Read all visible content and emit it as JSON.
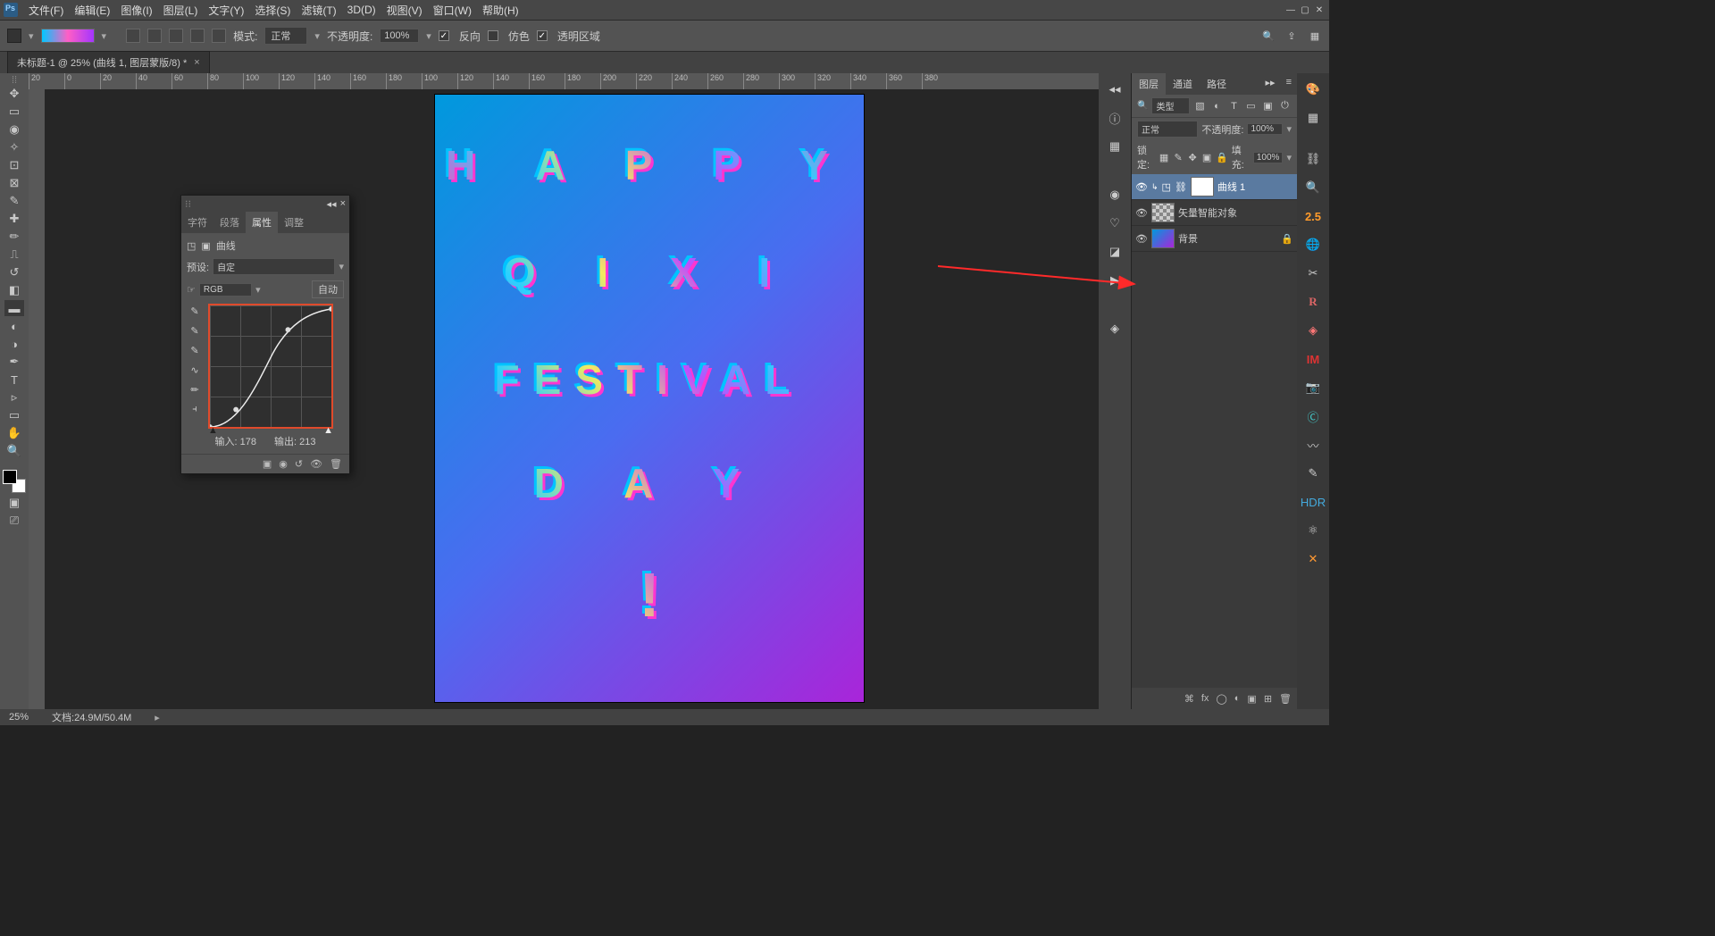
{
  "menu": [
    "文件(F)",
    "编辑(E)",
    "图像(I)",
    "图层(L)",
    "文字(Y)",
    "选择(S)",
    "滤镜(T)",
    "3D(D)",
    "视图(V)",
    "窗口(W)",
    "帮助(H)"
  ],
  "options": {
    "mode_label": "模式:",
    "mode_value": "正常",
    "opacity_label": "不透明度:",
    "opacity_value": "100%",
    "reverse": "反向",
    "dither": "仿色",
    "transparency": "透明区域"
  },
  "tab": {
    "title": "未标题-1 @ 25% (曲线 1, 图层蒙版/8) *"
  },
  "ruler_ticks": [
    "20",
    "0",
    "20",
    "40",
    "60",
    "80",
    "100",
    "120",
    "140",
    "160",
    "180",
    "100",
    "120",
    "140",
    "160",
    "180",
    "200",
    "220",
    "240",
    "260",
    "280",
    "300",
    "320",
    "340",
    "360",
    "380"
  ],
  "canvas_text": [
    "H A P P Y",
    "Q I X I",
    "FESTIVAL",
    "D A Y",
    "!"
  ],
  "prop": {
    "tabs": [
      "字符",
      "段落",
      "属性",
      "调整"
    ],
    "type": "曲线",
    "preset_label": "预设:",
    "preset_value": "自定",
    "channel": "RGB",
    "auto": "自动",
    "input_label": "输入:",
    "input_value": "178",
    "output_label": "输出:",
    "output_value": "213"
  },
  "layers_panel": {
    "tabs": [
      "图层",
      "通道",
      "路径"
    ],
    "filter": "类型",
    "blend": "正常",
    "opacity_label": "不透明度:",
    "opacity": "100%",
    "lock_label": "锁定:",
    "fill_label": "填充:",
    "fill": "100%",
    "layers": [
      {
        "name": "曲线 1",
        "selected": true,
        "thumb": "white",
        "extra": true
      },
      {
        "name": "矢量智能对象",
        "thumb": "smart"
      },
      {
        "name": "背景",
        "thumb": "grad",
        "locked": true
      }
    ]
  },
  "status": {
    "zoom": "25%",
    "doc": "文档:24.9M/50.4M"
  },
  "far_right_badge": "2.5"
}
